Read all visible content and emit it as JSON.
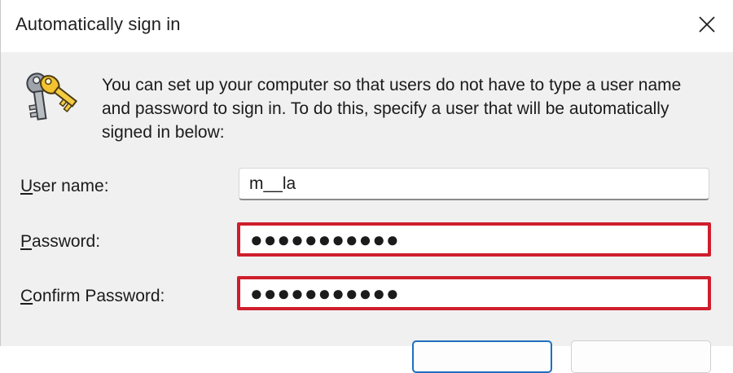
{
  "window": {
    "title": "Automatically sign in",
    "close_icon": "close-icon"
  },
  "intro": {
    "icon": "keys-icon",
    "text": "You can set up your computer so that users do not have to type a user name and password to sign in. To do this, specify a user that will be automatically signed in below:"
  },
  "form": {
    "username": {
      "label_accel": "U",
      "label_rest": "ser name:",
      "value": "m__la"
    },
    "password": {
      "label_accel": "P",
      "label_rest": "assword:",
      "value": "●●●●●●●●●●●"
    },
    "confirm": {
      "label_accel": "C",
      "label_rest": "onfirm Password:",
      "value": "●●●●●●●●●●●"
    }
  },
  "colors": {
    "highlight": "#cf1e2c",
    "primary_border": "#1f6fbf",
    "dialog_bg": "#f0f0f0"
  }
}
